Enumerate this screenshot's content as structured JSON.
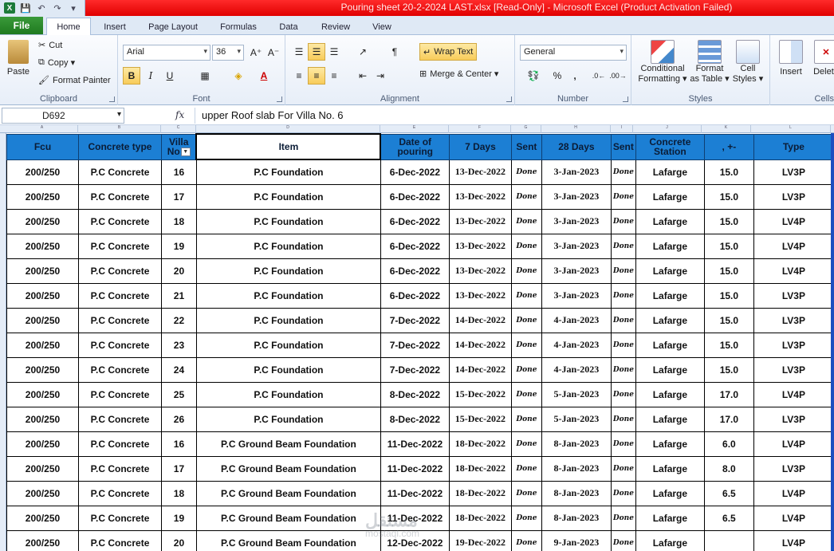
{
  "window": {
    "title": "Pouring sheet 20-2-2024 LAST.xlsx  [Read-Only]  -  Microsoft Excel (Product Activation Failed)"
  },
  "tabs": [
    "File",
    "Home",
    "Insert",
    "Page Layout",
    "Formulas",
    "Data",
    "Review",
    "View"
  ],
  "ribbon": {
    "clipboard": {
      "label": "Clipboard",
      "paste": "Paste",
      "cut": "Cut",
      "copy": "Copy ▾",
      "format_painter": "Format Painter"
    },
    "font": {
      "label": "Font",
      "name": "Arial",
      "size": "36",
      "bold": "B",
      "italic": "I",
      "underline": "U"
    },
    "alignment": {
      "label": "Alignment",
      "wrap_text": "Wrap Text",
      "merge_center": "Merge & Center ▾"
    },
    "number": {
      "label": "Number",
      "format": "General",
      "percent": "%",
      "comma": ","
    },
    "styles": {
      "label": "Styles",
      "conditional": "Conditional",
      "conditional2": "Formatting ▾",
      "format_table": "Format",
      "format_table2": "as Table ▾",
      "cell_styles": "Cell",
      "cell_styles2": "Styles ▾"
    },
    "cells": {
      "label": "Cells",
      "insert": "Insert",
      "delete": "Delete"
    }
  },
  "formula_bar": {
    "name_box": "D692",
    "fx": "fx",
    "content": "upper Roof slab For Villa No. 6"
  },
  "columns": [
    "A",
    "B",
    "C",
    "D",
    "E",
    "F",
    "G",
    "H",
    "I",
    "J",
    "K",
    "L"
  ],
  "table": {
    "headers": {
      "fcu": "Fcu",
      "concrete_type": "Concrete type",
      "villa_no": "Villa No",
      "item": "Item",
      "date_of_pouring": "Date of pouring",
      "days7": "7 Days",
      "sent1": "Sent",
      "days28": "28 Days",
      "sent2": "Sent",
      "station": "Concrete Station",
      "plusminus": ", +-",
      "type": "Type"
    },
    "rows": [
      [
        "200/250",
        "P.C Concrete",
        "16",
        "P.C Foundation",
        "6-Dec-2022",
        "13-Dec-2022",
        "Done",
        "3-Jan-2023",
        "Done",
        "Lafarge",
        "15.0",
        "LV3P"
      ],
      [
        "200/250",
        "P.C Concrete",
        "17",
        "P.C Foundation",
        "6-Dec-2022",
        "13-Dec-2022",
        "Done",
        "3-Jan-2023",
        "Done",
        "Lafarge",
        "15.0",
        "LV3P"
      ],
      [
        "200/250",
        "P.C Concrete",
        "18",
        "P.C Foundation",
        "6-Dec-2022",
        "13-Dec-2022",
        "Done",
        "3-Jan-2023",
        "Done",
        "Lafarge",
        "15.0",
        "LV4P"
      ],
      [
        "200/250",
        "P.C Concrete",
        "19",
        "P.C Foundation",
        "6-Dec-2022",
        "13-Dec-2022",
        "Done",
        "3-Jan-2023",
        "Done",
        "Lafarge",
        "15.0",
        "LV4P"
      ],
      [
        "200/250",
        "P.C Concrete",
        "20",
        "P.C Foundation",
        "6-Dec-2022",
        "13-Dec-2022",
        "Done",
        "3-Jan-2023",
        "Done",
        "Lafarge",
        "15.0",
        "LV4P"
      ],
      [
        "200/250",
        "P.C Concrete",
        "21",
        "P.C Foundation",
        "6-Dec-2022",
        "13-Dec-2022",
        "Done",
        "3-Jan-2023",
        "Done",
        "Lafarge",
        "15.0",
        "LV3P"
      ],
      [
        "200/250",
        "P.C Concrete",
        "22",
        "P.C Foundation",
        "7-Dec-2022",
        "14-Dec-2022",
        "Done",
        "4-Jan-2023",
        "Done",
        "Lafarge",
        "15.0",
        "LV3P"
      ],
      [
        "200/250",
        "P.C Concrete",
        "23",
        "P.C Foundation",
        "7-Dec-2022",
        "14-Dec-2022",
        "Done",
        "4-Jan-2023",
        "Done",
        "Lafarge",
        "15.0",
        "LV3P"
      ],
      [
        "200/250",
        "P.C Concrete",
        "24",
        "P.C Foundation",
        "7-Dec-2022",
        "14-Dec-2022",
        "Done",
        "4-Jan-2023",
        "Done",
        "Lafarge",
        "15.0",
        "LV3P"
      ],
      [
        "200/250",
        "P.C Concrete",
        "25",
        "P.C Foundation",
        "8-Dec-2022",
        "15-Dec-2022",
        "Done",
        "5-Jan-2023",
        "Done",
        "Lafarge",
        "17.0",
        "LV4P"
      ],
      [
        "200/250",
        "P.C Concrete",
        "26",
        "P.C Foundation",
        "8-Dec-2022",
        "15-Dec-2022",
        "Done",
        "5-Jan-2023",
        "Done",
        "Lafarge",
        "17.0",
        "LV3P"
      ],
      [
        "200/250",
        "P.C Concrete",
        "16",
        "P.C Ground Beam Foundation",
        "11-Dec-2022",
        "18-Dec-2022",
        "Done",
        "8-Jan-2023",
        "Done",
        "Lafarge",
        "6.0",
        "LV4P"
      ],
      [
        "200/250",
        "P.C Concrete",
        "17",
        "P.C Ground Beam Foundation",
        "11-Dec-2022",
        "18-Dec-2022",
        "Done",
        "8-Jan-2023",
        "Done",
        "Lafarge",
        "8.0",
        "LV3P"
      ],
      [
        "200/250",
        "P.C Concrete",
        "18",
        "P.C Ground Beam Foundation",
        "11-Dec-2022",
        "18-Dec-2022",
        "Done",
        "8-Jan-2023",
        "Done",
        "Lafarge",
        "6.5",
        "LV4P"
      ],
      [
        "200/250",
        "P.C Concrete",
        "19",
        "P.C Ground Beam Foundation",
        "11-Dec-2022",
        "18-Dec-2022",
        "Done",
        "8-Jan-2023",
        "Done",
        "Lafarge",
        "6.5",
        "LV4P"
      ],
      [
        "200/250",
        "P.C Concrete",
        "20",
        "P.C Ground Beam Foundation",
        "12-Dec-2022",
        "19-Dec-2022",
        "Done",
        "9-Jan-2023",
        "Done",
        "Lafarge",
        "",
        "LV4P"
      ]
    ]
  },
  "watermark": {
    "arabic": "مستقل",
    "latin": "mostaql.com"
  }
}
